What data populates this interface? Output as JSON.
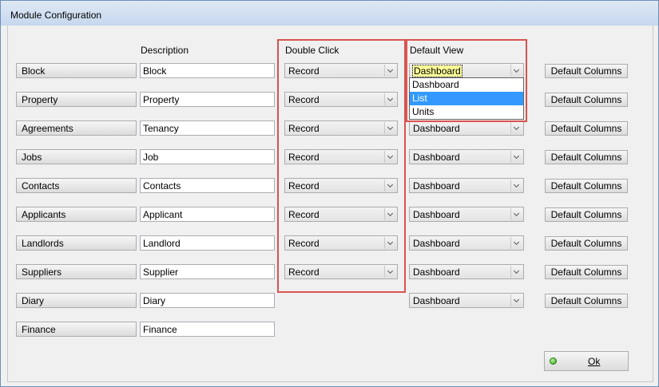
{
  "window": {
    "title": "Module Configuration"
  },
  "headers": {
    "description": "Description",
    "double_click": "Double Click",
    "default_view": "Default View"
  },
  "rows": [
    {
      "module": "Block",
      "description": "Block",
      "double_click": "Record",
      "default_view": "Dashboard",
      "columns_label": "Default Columns"
    },
    {
      "module": "Property",
      "description": "Property",
      "double_click": "Record",
      "default_view": "",
      "columns_label": "Default Columns"
    },
    {
      "module": "Agreements",
      "description": "Tenancy",
      "double_click": "Record",
      "default_view": "Dashboard",
      "columns_label": "Default Columns"
    },
    {
      "module": "Jobs",
      "description": "Job",
      "double_click": "Record",
      "default_view": "Dashboard",
      "columns_label": "Default Columns"
    },
    {
      "module": "Contacts",
      "description": "Contacts",
      "double_click": "Record",
      "default_view": "Dashboard",
      "columns_label": "Default Columns"
    },
    {
      "module": "Applicants",
      "description": "Applicant",
      "double_click": "Record",
      "default_view": "Dashboard",
      "columns_label": "Default Columns"
    },
    {
      "module": "Landlords",
      "description": "Landlord",
      "double_click": "Record",
      "default_view": "Dashboard",
      "columns_label": "Default Columns"
    },
    {
      "module": "Suppliers",
      "description": "Supplier",
      "double_click": "Record",
      "default_view": "Dashboard",
      "columns_label": "Default Columns"
    },
    {
      "module": "Diary",
      "description": "Diary",
      "double_click": "",
      "default_view": "Dashboard",
      "columns_label": "Default Columns"
    },
    {
      "module": "Finance",
      "description": "Finance",
      "double_click": "",
      "default_view": "",
      "columns_label": ""
    }
  ],
  "dropdown": {
    "options": [
      "Dashboard",
      "List",
      "Units"
    ],
    "highlighted": "List"
  },
  "ok_button": {
    "label": "Ok",
    "icon": "green-status-dot-icon"
  },
  "colors": {
    "highlight_box": "#d9534f",
    "selected_option": "#3399ff",
    "focus_value": "#ffff99"
  }
}
